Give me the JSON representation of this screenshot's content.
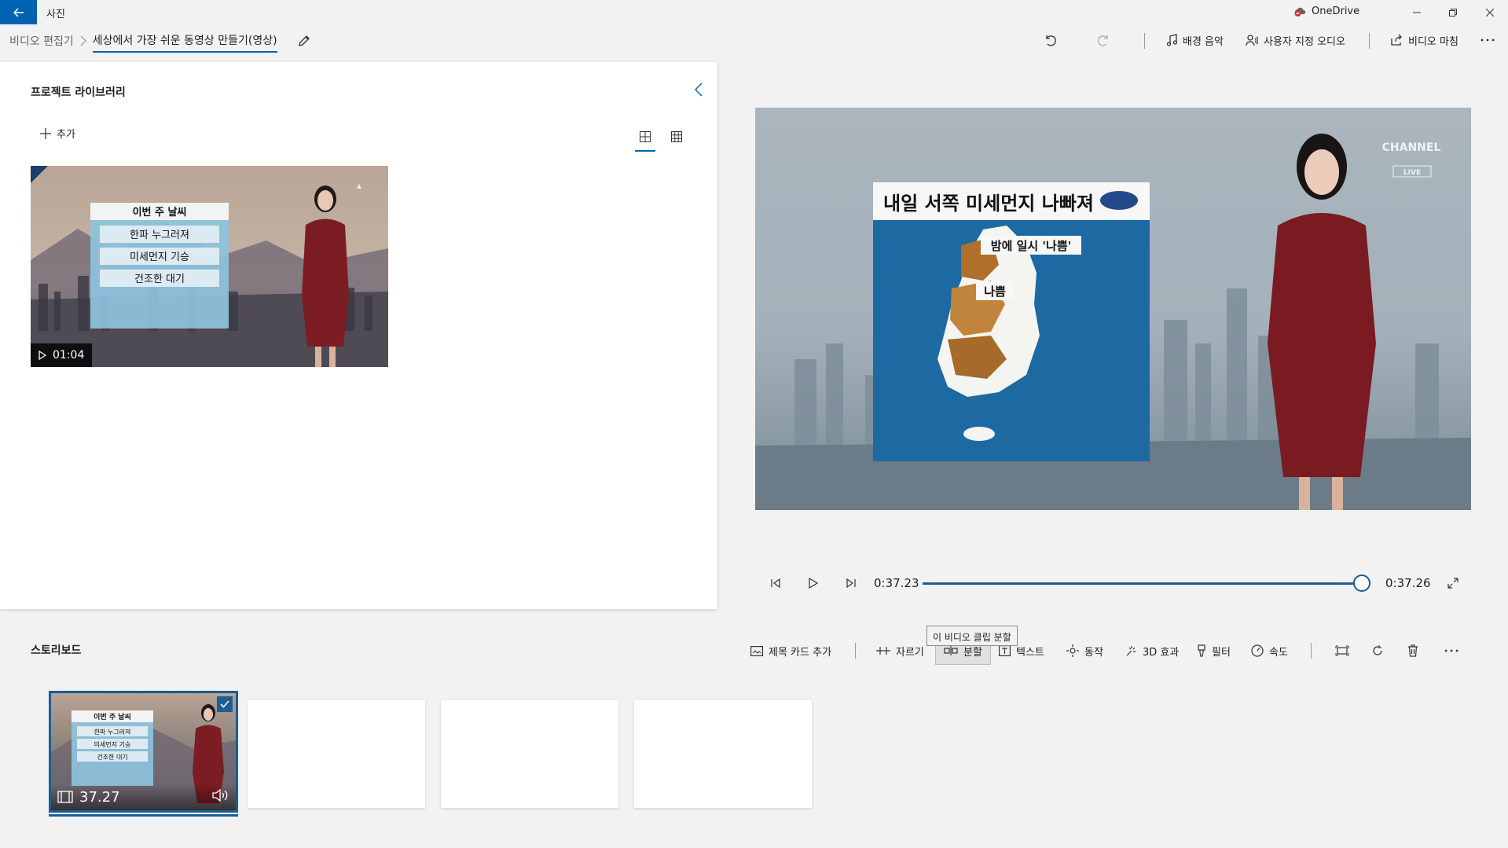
{
  "titlebar": {
    "app_title": "사진",
    "onedrive_label": "OneDrive"
  },
  "breadcrumb": {
    "root": "비디오 편집기",
    "current": "세상에서 가장 쉬운 동영상 만들기(영상)"
  },
  "toolbar": {
    "bg_music": "배경 음악",
    "custom_audio": "사용자 지정 오디오",
    "finish_video": "비디오 마침"
  },
  "library": {
    "title": "프로젝트 라이브러리",
    "add_label": "추가",
    "thumb": {
      "duration": "01:04",
      "board_title": "이번 주 날씨",
      "board_lines": [
        "한파 누그러져",
        "미세먼지 기승",
        "건조한 대기"
      ]
    }
  },
  "preview": {
    "headline": "내일 서쪽 미세먼지 나빠져",
    "label_top": "밤에 일시 '나쁨'",
    "label_mid": "나쁨",
    "logo_top": "CHANNEL",
    "logo_bottom": "LIVE"
  },
  "player": {
    "current_time": "0:37.23",
    "end_time": "0:37.26",
    "progress": 0.985
  },
  "storyboard": {
    "title": "스토리보드",
    "tooltip": "이 비디오 클립 분할",
    "buttons": {
      "title_card": "제목 카드 추가",
      "trim": "자르기",
      "split": "분할",
      "text": "텍스트",
      "motion": "동작",
      "effects3d": "3D 효과",
      "filter": "필터",
      "speed": "속도"
    },
    "clip": {
      "duration": "37.27",
      "board_title": "이번 주 날씨",
      "board_lines": [
        "한파 누그러져",
        "미세먼지 기승",
        "건조한 대기"
      ]
    }
  },
  "colors": {
    "accent": "#0063b1",
    "selection": "#1b5d94"
  }
}
